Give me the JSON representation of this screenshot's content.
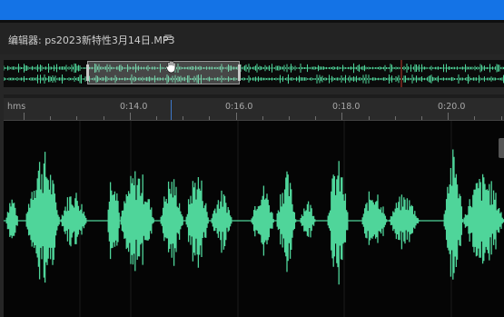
{
  "panel": {
    "title": "编辑器: ps2023新特性3月14日.MP3",
    "menu_icon": "hamburger-menu-icon"
  },
  "timeline": {
    "unit_label": "hms",
    "time_labels": [
      "0:14.0",
      "0:16.0",
      "0:18.0",
      "0:20.0"
    ]
  },
  "colors": {
    "accent_bar": "#1473e6",
    "waveform": "#4fd59a",
    "playhead": "#3d78c9"
  },
  "overview": {
    "cursor_icon": "hand-grab-icon"
  }
}
